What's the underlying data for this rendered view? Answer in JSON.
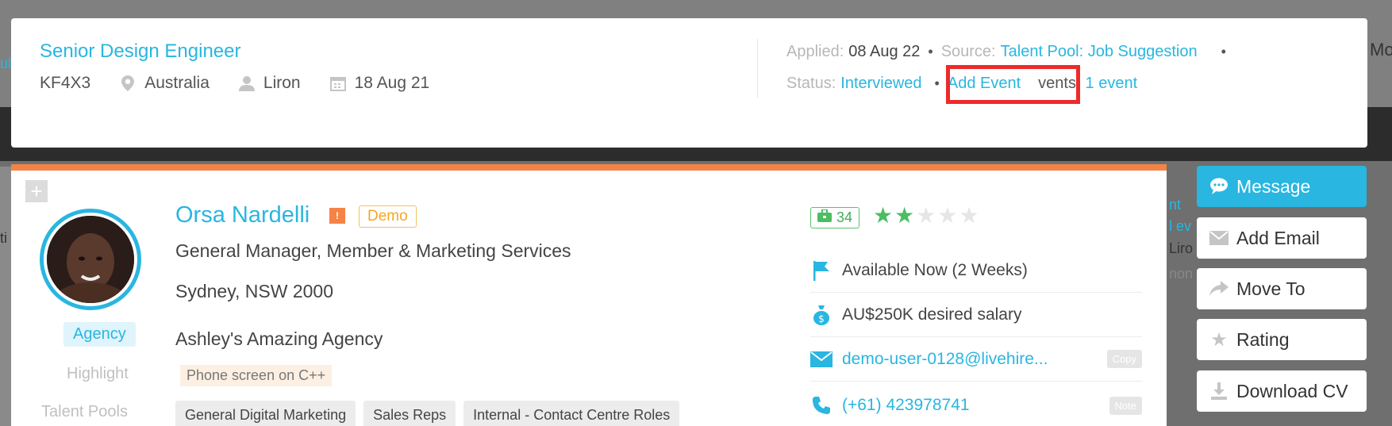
{
  "background": {
    "left_fragments": [
      "ul",
      "ti"
    ],
    "right_fragments": [
      "nt",
      "l ev",
      "Liro",
      "non"
    ],
    "top_right_fragment": "Mo"
  },
  "job": {
    "title": "Senior Design Engineer",
    "ref": "KF4X3",
    "location": "Australia",
    "owner": "Liron",
    "date": "18 Aug 21",
    "applied_label": "Applied:",
    "applied_value": "08 Aug 22",
    "source_label": "Source:",
    "source_value": "Talent Pool: Job Suggestion",
    "status_label": "Status:",
    "status_value": "Interviewed",
    "add_event_label": "Add Event",
    "events_label": "Events:",
    "events_value": "1 event",
    "events_label_visible": "vents:"
  },
  "candidate": {
    "name": "Orsa Nardelli",
    "flag_label": "!",
    "demo_label": "Demo",
    "title": "General Manager, Member & Marketing Services",
    "location": "Sydney, NSW 2000",
    "agency": "Ashley's Amazing Agency",
    "agency_badge": "Agency",
    "highlight_label": "Highlight",
    "highlight_note": "Phone screen on C++",
    "talent_pools_label": "Talent Pools",
    "tags": [
      "General Digital Marketing",
      "Sales Reps",
      "Internal - Contact Centre Roles"
    ],
    "score": "34",
    "rating": 2,
    "rating_max": 5,
    "availability": "Available Now (2 Weeks)",
    "salary": "AU$250K desired salary",
    "email": "demo-user-0128@livehire...",
    "copy_label": "Copy",
    "phone": "(+61) 423978741",
    "note_label": "Note"
  },
  "actions": {
    "message": "Message",
    "add_email": "Add Email",
    "move_to": "Move To",
    "rating": "Rating",
    "download_cv": "Download CV"
  },
  "colors": {
    "accent": "#29b6e0",
    "highlight_box": "#ee2a2a",
    "card_top_bar": "#f58345",
    "star_on": "#4cbd63"
  }
}
